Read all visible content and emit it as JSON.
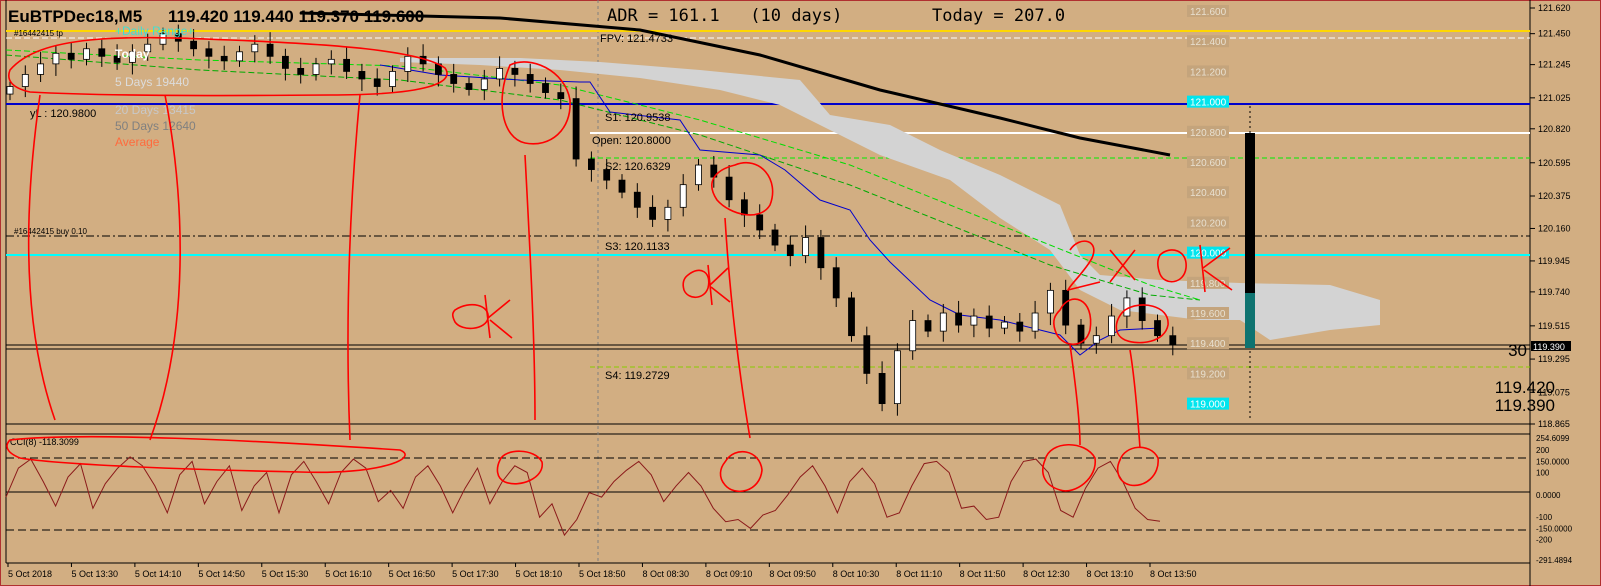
{
  "window": {
    "title": "EuBTPDec18,M5",
    "quote": "119.420 119.440 119.370 119.600",
    "adr_label": "ADR = 161.1   (10 days)",
    "today_label": "Today = 207.0"
  },
  "colors": {
    "background": "#d2ae82",
    "bull": "#ffffff",
    "bear": "#000000",
    "cci": "#8b1a1a",
    "ink": "#ff0000",
    "kijun": "#0000cc",
    "ma": "#00aa00",
    "cloud": "#d3d3d3",
    "sr_cyan": "#00ffff",
    "ma_slow": "#000000"
  },
  "chart_data": [
    {
      "type": "candlestick",
      "title": "EuBTPDec18,M5 119.420 119.440 119.370 119.600",
      "ylim": [
        118.865,
        121.62
      ],
      "yticks": [
        "121.620",
        "121.450",
        "121.245",
        "121.025",
        "120.820",
        "120.595",
        "120.375",
        "120.160",
        "119.945",
        "119.740",
        "119.515",
        "119.295",
        "119.075",
        "118.865"
      ],
      "xticks": [
        "5 Oct 2018",
        "5 Oct 13:30",
        "5 Oct 14:10",
        "5 Oct 14:50",
        "5 Oct 15:30",
        "5 Oct 16:10",
        "5 Oct 16:50",
        "5 Oct 17:30",
        "5 Oct 18:10",
        "5 Oct 18:50",
        "8 Oct 08:30",
        "8 Oct 09:10",
        "8 Oct 09:50",
        "8 Oct 10:30",
        "8 Oct 11:10",
        "8 Oct 11:50",
        "8 Oct 12:30",
        "8 Oct 13:10",
        "8 Oct 13:50"
      ],
      "closes": [
        121.1,
        121.18,
        121.25,
        121.32,
        121.28,
        121.35,
        121.3,
        121.26,
        121.33,
        121.38,
        121.45,
        121.4,
        121.35,
        121.3,
        121.27,
        121.33,
        121.38,
        121.3,
        121.22,
        121.18,
        121.25,
        121.28,
        121.2,
        121.15,
        121.1,
        121.2,
        121.3,
        121.25,
        121.18,
        121.12,
        121.08,
        121.15,
        121.22,
        121.18,
        121.12,
        121.06,
        121.02,
        120.62,
        120.55,
        120.48,
        120.4,
        120.3,
        120.22,
        120.3,
        120.45,
        120.58,
        120.5,
        120.35,
        120.25,
        120.15,
        120.05,
        119.98,
        120.1,
        119.9,
        119.7,
        119.45,
        119.2,
        119.0,
        119.35,
        119.55,
        119.48,
        119.6,
        119.52,
        119.58,
        119.5,
        119.54,
        119.48,
        119.6,
        119.75,
        119.52,
        119.4,
        119.45,
        119.58,
        119.7,
        119.55,
        119.45,
        119.39
      ],
      "levels": [
        {
          "name": "FPV",
          "label": "FPV: 121.4733",
          "price": 121.4733
        },
        {
          "name": "yL",
          "label": "yL : 120.9800",
          "price": 120.98
        },
        {
          "name": "S1",
          "label": "S1: 120.9538",
          "price": 120.9538
        },
        {
          "name": "Open",
          "label": "Open: 120.8000",
          "price": 120.8
        },
        {
          "name": "S2",
          "label": "S2: 120.6329",
          "price": 120.6329
        },
        {
          "name": "S3",
          "label": "S3: 120.1133",
          "price": 120.1133
        },
        {
          "name": "S4",
          "label": "S4: 119.2729",
          "price": 119.2729
        }
      ],
      "sr_labels": [
        "121.600",
        "121.400",
        "121.200",
        "121.000",
        "120.800",
        "120.600",
        "120.400",
        "120.200",
        "120.000",
        "119.800",
        "119.600",
        "119.400",
        "119.200",
        "119.000"
      ],
      "order_lines": [
        {
          "label": "#16442415 tp",
          "price": 121.45
        },
        {
          "label": "#16442415 buy 0.10",
          "price": 120.16
        }
      ],
      "current_price": "119.390",
      "current_price_label": "119.420",
      "bid": "119.420",
      "ask": "119.390",
      "timer": "30"
    },
    {
      "type": "line",
      "title": "CCI(8) -118.3099",
      "ylim": [
        -291.4894,
        254.6099
      ],
      "yticks": [
        "254.6099",
        "200",
        "150.0000",
        "100",
        "0.0000",
        "-100",
        "-150.0000",
        "-200",
        "-291.4894"
      ],
      "levels": [
        150,
        0,
        -150
      ],
      "values": [
        -10,
        120,
        160,
        60,
        -50,
        80,
        140,
        -60,
        50,
        120,
        170,
        130,
        40,
        -80,
        90,
        150,
        -40,
        60,
        130,
        -70,
        40,
        100,
        -80,
        90,
        150,
        60,
        -40,
        100,
        160,
        120,
        -30,
        20,
        -60,
        80,
        130,
        40,
        -80,
        30,
        120,
        -40,
        60,
        130,
        100,
        -100,
        -40,
        -180,
        -110,
        10,
        -10,
        60,
        110,
        150,
        90,
        -30,
        40,
        100,
        40,
        -60,
        -120,
        -110,
        -150,
        -90,
        -70,
        0,
        80,
        130,
        40,
        -80,
        60,
        120,
        50,
        -100,
        -80,
        40,
        140,
        150,
        100,
        -60,
        -50,
        -110,
        -100,
        60,
        150,
        160,
        100,
        -70,
        -100,
        30,
        120,
        150,
        60,
        -60,
        -110,
        -118
      ]
    }
  ],
  "overlay_labels": {
    "daily_range": "+Daily Range+",
    "today": "Today",
    "d5": "5 Days   19440",
    "d20": "20 Days  13415",
    "d50": "50 Days  12640",
    "average": "Average"
  },
  "handwriting": [
    "OK",
    "OK",
    "2 X OK"
  ]
}
